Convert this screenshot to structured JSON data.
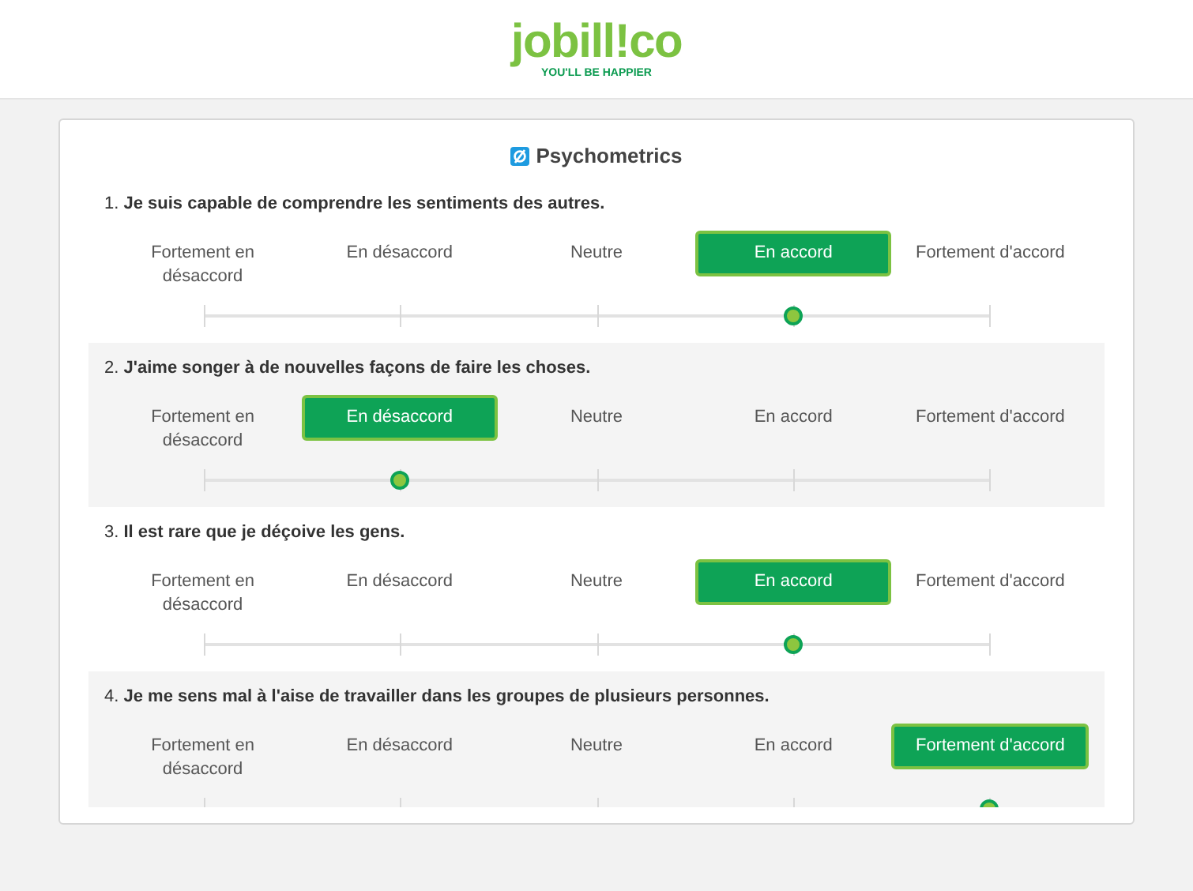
{
  "logo": {
    "name": "jobill!co",
    "tagline": "YOU'LL BE HAPPIER"
  },
  "panel_title": "Psychometrics",
  "questions": [
    {
      "number": "1.",
      "text": "Je suis capable de comprendre les sentiments des autres.",
      "level": 0.75,
      "options": [
        {
          "label": "Fortement en désaccord",
          "selected": false
        },
        {
          "label": "En désaccord",
          "selected": false
        },
        {
          "label": "Neutre",
          "selected": false
        },
        {
          "label": "En accord",
          "selected": true
        },
        {
          "label": "Fortement d'accord",
          "selected": false
        }
      ]
    },
    {
      "number": "2.",
      "text": "J'aime songer à de nouvelles façons de faire les choses.",
      "level": 0.25,
      "options": [
        {
          "label": "Fortement en désaccord",
          "selected": false
        },
        {
          "label": "En désaccord",
          "selected": true
        },
        {
          "label": "Neutre",
          "selected": false
        },
        {
          "label": "En accord",
          "selected": false
        },
        {
          "label": "Fortement d'accord",
          "selected": false
        }
      ]
    },
    {
      "number": "3.",
      "text": "Il est rare que je déçoive les gens.",
      "level": 0.75,
      "options": [
        {
          "label": "Fortement en désaccord",
          "selected": false
        },
        {
          "label": "En désaccord",
          "selected": false
        },
        {
          "label": "Neutre",
          "selected": false
        },
        {
          "label": "En accord",
          "selected": true
        },
        {
          "label": "Fortement d'accord",
          "selected": false
        }
      ]
    },
    {
      "number": "4.",
      "text": "Je me sens mal à l'aise de travailler dans les groupes de plusieurs personnes.",
      "level": 1.0,
      "options": [
        {
          "label": "Fortement en désaccord",
          "selected": false
        },
        {
          "label": "En désaccord",
          "selected": false
        },
        {
          "label": "Neutre",
          "selected": false
        },
        {
          "label": "En accord",
          "selected": false
        },
        {
          "label": "Fortement d'accord",
          "selected": true
        }
      ]
    }
  ]
}
